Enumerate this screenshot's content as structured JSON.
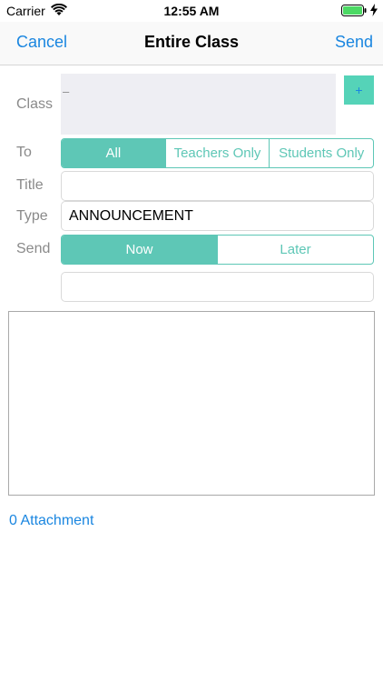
{
  "status_bar": {
    "carrier": "Carrier",
    "time": "12:55 AM"
  },
  "nav": {
    "cancel_label": "Cancel",
    "title": "Entire Class",
    "send_label": "Send"
  },
  "form": {
    "class_label": "Class",
    "class_value": "–",
    "add_label": "+",
    "to_label": "To",
    "to_options": [
      "All",
      "Teachers Only",
      "Students Only"
    ],
    "to_selected": "All",
    "title_label": "Title",
    "title_value": "",
    "type_label": "Type",
    "type_value": "ANNOUNCEMENT",
    "send_label": "Send",
    "send_options": [
      "Now",
      "Later"
    ],
    "send_selected": "Now",
    "extra_value": "",
    "message_value": ""
  },
  "attachment_label": "0 Attachment",
  "colors": {
    "accent": "#5ec7b6",
    "link": "#1a86e0",
    "add_button": "#55d3b8",
    "class_box": "#eeeef3",
    "battery": "#4cd964"
  }
}
